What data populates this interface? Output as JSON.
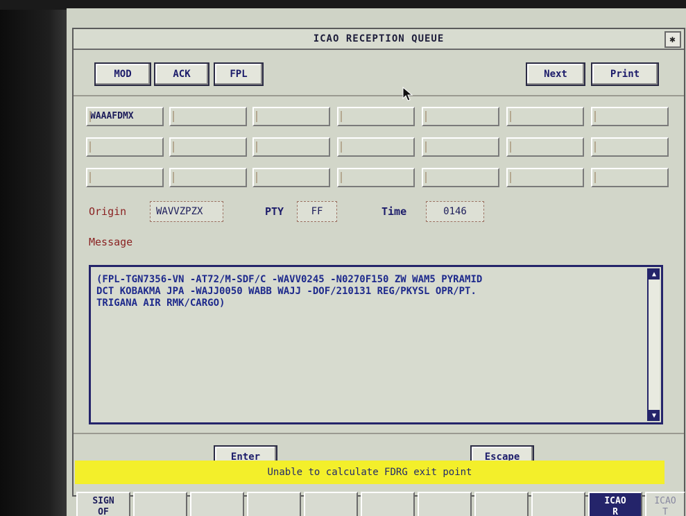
{
  "window": {
    "title": "ICAO RECEPTION QUEUE",
    "close_glyph": "✱"
  },
  "toolbar": {
    "mod": "MOD",
    "ack": "ACK",
    "fpl": "FPL",
    "next": "Next",
    "print": "Print"
  },
  "grid": {
    "rows": [
      [
        "WAAAFDMX",
        "",
        "",
        "",
        "",
        "",
        ""
      ],
      [
        "",
        "",
        "",
        "",
        "",
        "",
        ""
      ],
      [
        "",
        "",
        "",
        "",
        "",
        "",
        ""
      ]
    ]
  },
  "header_fields": {
    "origin_label": "Origin",
    "origin_value": "WAVVZPZX",
    "pty_label": "PTY",
    "pty_value": "FF",
    "time_label": "Time",
    "time_value": "0146"
  },
  "message": {
    "label": "Message",
    "text": "(FPL-TGN7356-VN -AT72/M-SDF/C -WAVV0245 -N0270F150 ZW WAM5 PYRAMID\nDCT KOBAKMA JPA -WAJJ0050 WABB WAJJ -DOF/210131 REG/PKYSL OPR/PT.\nTRIGANA AIR RMK/CARGO)"
  },
  "actions": {
    "enter": "Enter",
    "escape": "Escape"
  },
  "status": {
    "text": "Unable to calculate FDRG exit point",
    "color": "#f3ef2a"
  },
  "function_keys": [
    {
      "label": "SIGN\nOF"
    },
    {
      "label": ""
    },
    {
      "label": ""
    },
    {
      "label": ""
    },
    {
      "label": ""
    },
    {
      "label": ""
    },
    {
      "label": ""
    },
    {
      "label": ""
    },
    {
      "label": ""
    },
    {
      "label": "ICAO\nR"
    },
    {
      "label": "ICAO\nT"
    }
  ]
}
